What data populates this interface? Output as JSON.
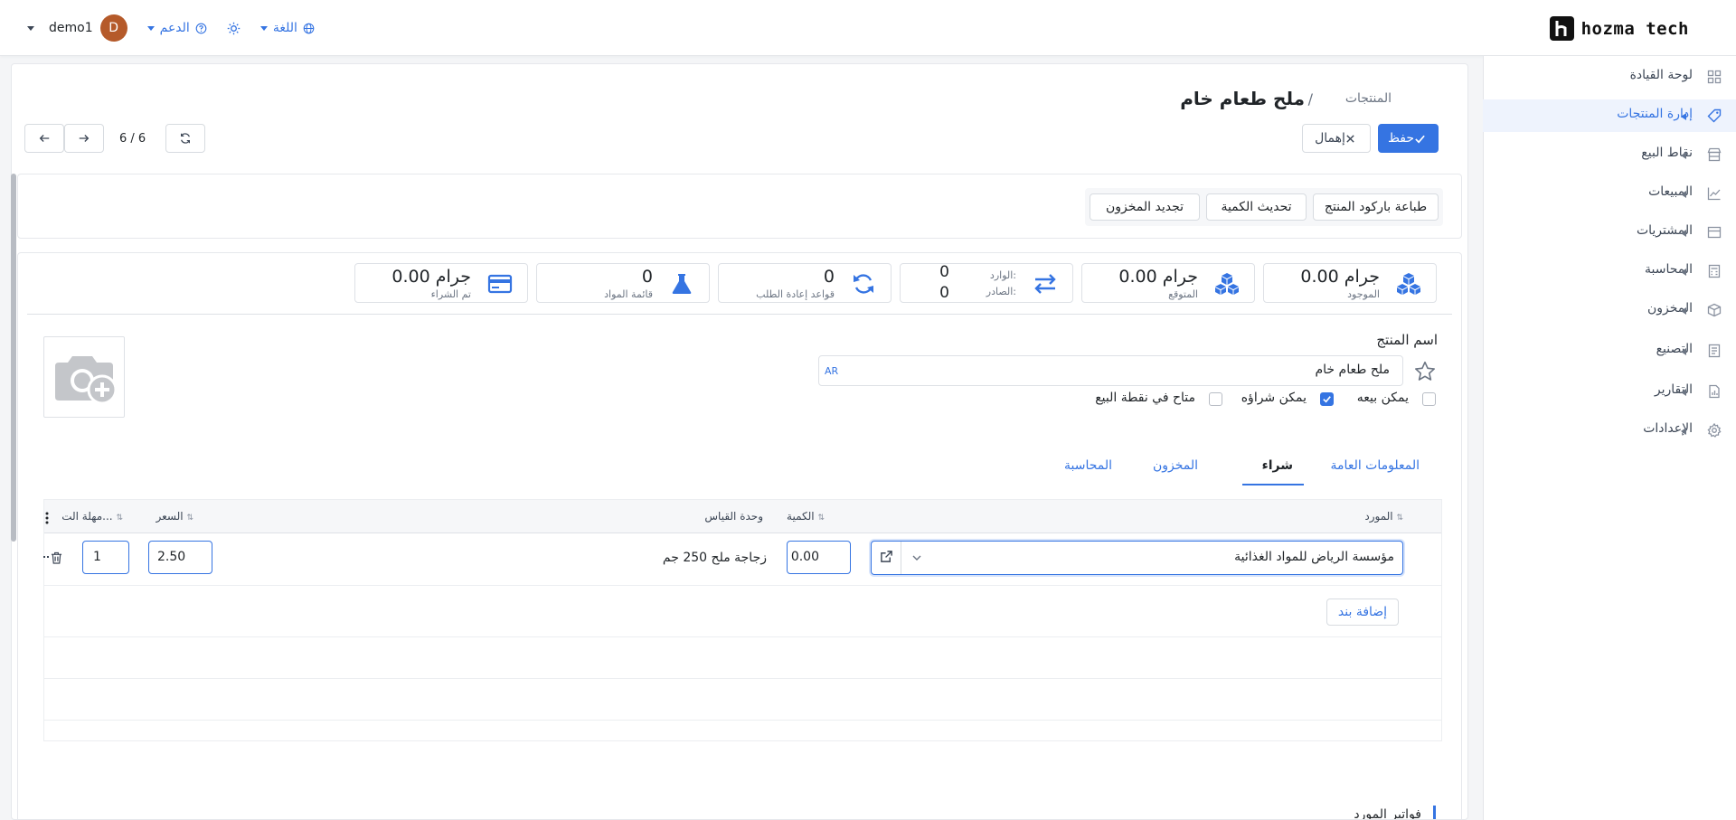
{
  "brand": {
    "name": "hozma tech"
  },
  "topnav": {
    "user": "demo1",
    "avatar_initial": "D",
    "support": "الدعم",
    "language": "اللغة"
  },
  "sidebar": {
    "items": [
      {
        "label": "لوحة القيادة",
        "icon": "dashboard-icon"
      },
      {
        "label": "إدارة المنتجات",
        "icon": "tag-icon",
        "active": true
      },
      {
        "label": "نقاط البيع",
        "icon": "store-icon"
      },
      {
        "label": "المبيعات",
        "icon": "chart-icon"
      },
      {
        "label": "المشتريات",
        "icon": "card-icon"
      },
      {
        "label": "المحاسبة",
        "icon": "calculator-icon"
      },
      {
        "label": "المخزون",
        "icon": "box-icon"
      },
      {
        "label": "التصنيع",
        "icon": "document-icon"
      },
      {
        "label": "التقارير",
        "icon": "report-icon"
      },
      {
        "label": "الإعدادات",
        "icon": "gear-icon"
      }
    ]
  },
  "breadcrumb": {
    "parent": "المنتجات",
    "separator": "/",
    "title": "ملح طعام خام"
  },
  "toolbar": {
    "save": "حفظ",
    "discard": "إهمال",
    "pager": "6 / 6"
  },
  "actions": {
    "print_barcode": "طباعة باركود المنتج",
    "update_qty": "تحديث الكمية",
    "replenish": "تجديد المخزون"
  },
  "stats": {
    "on_hand": {
      "value": "0.00 جرام",
      "label": "الموجود"
    },
    "forecast": {
      "value": "0.00 جرام",
      "label": "المتوقع"
    },
    "moves": {
      "in_label": "الوارد:",
      "in_value": "0",
      "out_label": "الصادر:",
      "out_value": "0"
    },
    "reorder": {
      "value": "0",
      "label": "قواعد إعادة الطلب"
    },
    "bom": {
      "value": "0",
      "label": "قائمة المواد"
    },
    "purchased": {
      "value": "0.00 جرام",
      "label": "تم الشراء"
    }
  },
  "form": {
    "name_label": "اسم المنتج",
    "name_value": "ملح طعام خام",
    "lang": "AR",
    "checks": {
      "can_sell": {
        "label": "يمكن بيعه",
        "checked": false
      },
      "can_buy": {
        "label": "يمكن شراؤه",
        "checked": true
      },
      "pos": {
        "label": "متاح في نقطة البيع",
        "checked": false
      }
    }
  },
  "tabs": [
    {
      "label": "المعلومات العامة"
    },
    {
      "label": "شراء",
      "active": true
    },
    {
      "label": "المخزون"
    },
    {
      "label": "المحاسبة"
    }
  ],
  "grid": {
    "headers": {
      "vendor": "المورد",
      "quantity": "الكمية",
      "uom": "وحدة القياس",
      "price": "السعر",
      "lead": "مهلة الت..."
    },
    "row": {
      "vendor": "مؤسسة الرياض للمواد الغذائية",
      "quantity": "0.00",
      "uom": "زجاجة ملح 250 جم",
      "price": "2.50",
      "lead": "1"
    },
    "add_line": "إضافة بند"
  },
  "section": {
    "vendor_bills": "فواتير المورد"
  },
  "colors": {
    "accent": "#3574e2",
    "avatar": "#b55a2a"
  }
}
